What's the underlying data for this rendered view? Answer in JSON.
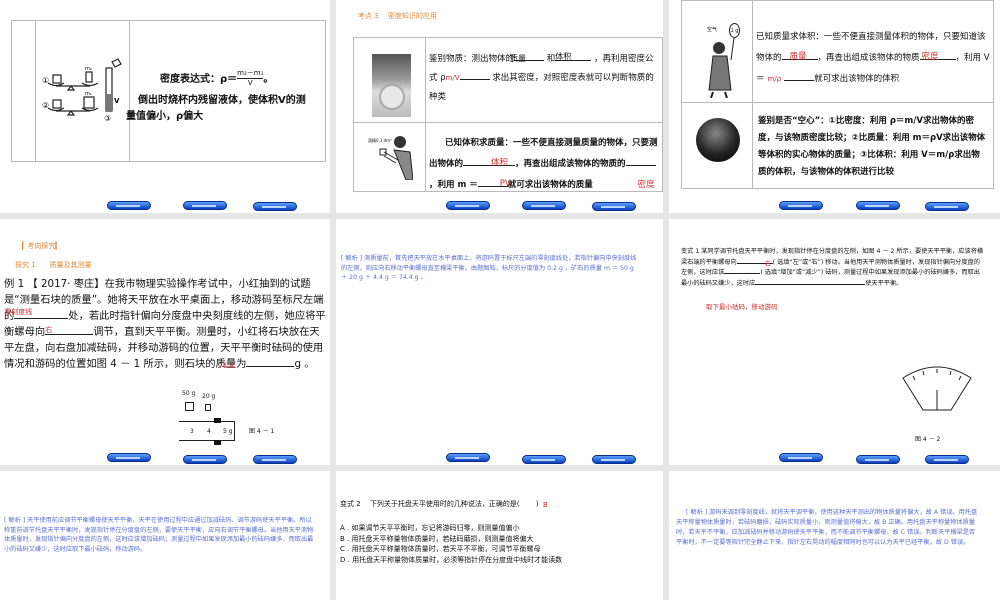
{
  "slides": [
    {
      "formula_label": "密度表达式：ρ＝",
      "formula_num": "m₂－m₁",
      "formula_den": "V",
      "formula_end": "。",
      "text": "倒出时烧杯内残留液体，使体积V的测量值偏小，ρ偏大",
      "fig_labels": [
        "①",
        "②",
        "③",
        "m₂",
        "m₁",
        "V"
      ]
    },
    {
      "heading": "考点 3　 密度知识的应用",
      "row1": {
        "p1": "鉴别物质：测出物体的",
        "ans1": "质量",
        "p2": "和",
        "ans2": "体积",
        "p3": "，再利用密度公式 ρ",
        "ans3": "m/V",
        "p4": "求出其密度，对照密度表就可以判断物质的种类"
      },
      "row2": {
        "p1": "已知体积求质量：一些不便直接测量质量的物体，只要测出物体的",
        "ans1": "体积",
        "p2": "，再查出组成该物体的物质的",
        "ans2": "密度",
        "p3": "，利用 m ＝",
        "ans3": "PV",
        "p4": "就可求出该物体的质量",
        "img_label": "酒精0.1 dm³"
      }
    },
    {
      "row1": {
        "p1": "已知质量求体积：一些不便直接测量体积的物体，只要知道该物体的",
        "ans1": "质量",
        "p2": "，再查出组成该物体的物质",
        "ans2": "密度",
        "p3": "，利用 V ＝",
        "ans3": "m/ρ",
        "p4": "就可求出该物体的体积",
        "img_label1": "空气",
        "img_label2": "1 g"
      },
      "row2": {
        "text": "鉴别是否“空心”：①比密度：利用 ρ＝m/V求出物体的密度，与该物质密度比较；②比质量：利用 m＝ρV求出该物体等体积的实心物体的质量；③比体积：利用 V＝m/ρ求出物质的体积，与该物体的体积进行比较"
      }
    },
    {
      "tag": "▎考向探究▎",
      "heading": "探究 1　　质量及其测量",
      "p1": "例 1 【 2017· 枣庄】在我市物理实验操作考试中，小红抽到的试题是“测量石块的质量”。她将天平放在水平桌面上，移动游码至标尺左端的",
      "ans1": "零刻度线",
      "p2": "处，若此时指针偏向分度盘中央刻度线的左侧，她应将平衡螺母向",
      "ans2": "右",
      "p3": "调节，直到天平平衡。测量时，小红将石块放在天平左盘，向右盘加减砝码，并移动游码的位置，天平平衡时砝码的使用情况和游码的位置如图 4 － 1 所示，则石块的质量为",
      "ans3": "74.4",
      "p4": "g 。",
      "fig": {
        "w1": "50 g",
        "w2": "20 g",
        "ticks": [
          "3",
          "4",
          "5 g"
        ],
        "caption": "图 4 － 1"
      }
    },
    {
      "text": "[ 解析 ] 测质量前，首先把天平放在水平桌面上，将游码置于标尺左端的零刻度线处，若指针偏向中央刻度线的左侧，则应向右移动平衡螺母直至横梁平衡。由题图知，标尺的分度值为 0.2 g ，矿石的质量 m ＝ 50 g ＋ 20 g ＋ 4.4 g ＝ 74.4 g 。"
    },
    {
      "p1": "变式 1 某同学调节托盘天平平衡时，发现指针停在分度盘的左侧，如图 4 － 2 所示，要使天平平衡，应该将横梁右端的平衡螺母向",
      "ans1": "右",
      "p2": "( 选填“左”或“右”) 移动。当他用天平测物体质量时，发现指针偏向分度盘的左侧，这时应该",
      "ans2": "增加",
      "p3": "( 选填“增加”或“减少”) 砝码，测量过程中如果发现添加最小的砝码嫌多，而取出最小的砝码又嫌少，这时应",
      "p4": "使天平平衡。",
      "ans3": "取下最小砝码，移动游码",
      "caption": "图 4 － 2"
    },
    {
      "text": "[ 解析 ] 天平使用前应调节平衡螺母使天平平衡，天平在使用过程中应通过加减砝码、调节游码使天平平衡。所以称重前调节托盘天平平衡时，发现指针停在分度盘的左侧，要使天平平衡，应向右调节平衡螺母。当他用天平测物体质量时，发现指针偏向分度盘的左侧，这时应该增加砝码；测量过程中如果发现添加最小的砝码嫌多，而取出最小的砝码又嫌少，这时应取下最小砝码，移动游码。"
    },
    {
      "q": "变式 2　 下列关于托盘天平使用时的几种说法，正确的是(　　 )",
      "ans": "B",
      "options": [
        "A . 如果调节天平平衡时，忘记将游码归零，则测量值偏小",
        "B . 用托盘天平称量物体质量时，若砝码磨损，则测量值将偏大",
        "C . 用托盘天平称量物体质量时，若天平不平衡，可调节平衡螺母",
        "D . 用托盘天平称量物体质量时，必须等指针停在分度盘中线时才能读数"
      ]
    },
    {
      "text": "[ 解析 ] 游码未调到零刻度线，就将天平调平衡，使用这种天平测出的物体质量将偏大，故 A 错误。用托盘天平称量物体质量时，若砝码磨损，砝码实际质量小，则测量值将偏大，故 B 正确。用托盘天平称量物体质量时，若天平不平衡，应加减砝码并移动游码使天平平衡，而不能调节平衡螺母，故 C 错误。判断天平横梁是否平衡时，不一定要等指针完全静止下来，指针左右晃动的幅度相同时也可以认为天平已经平衡，故 D 错误。"
    }
  ]
}
